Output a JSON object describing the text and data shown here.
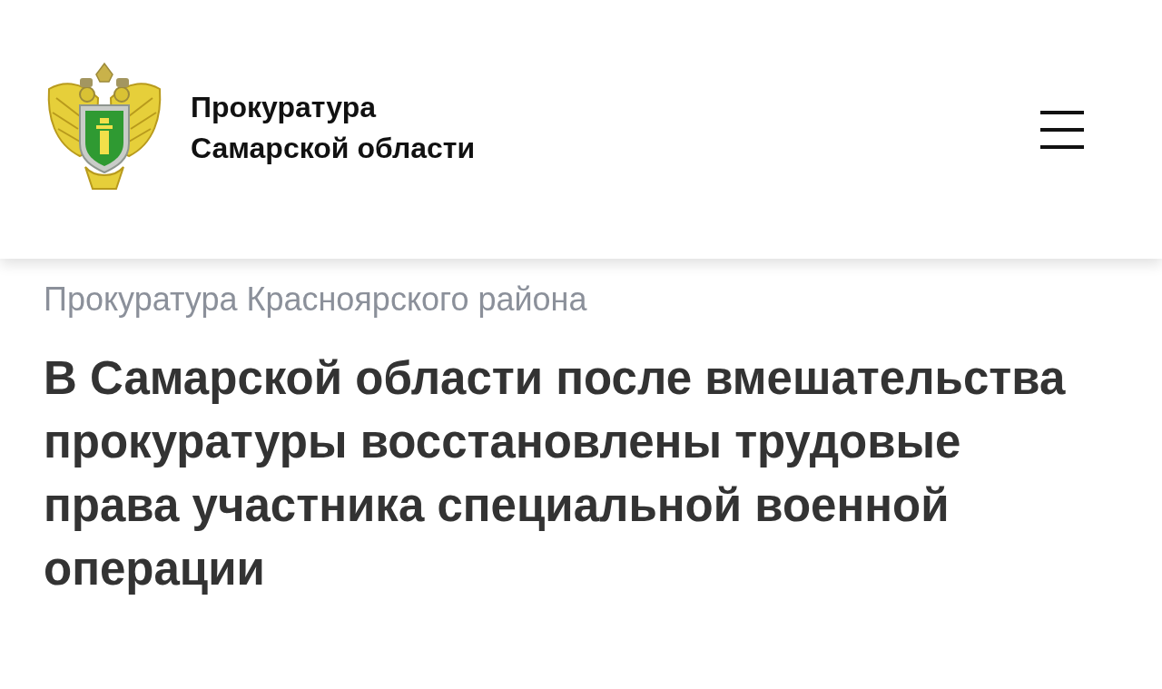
{
  "header": {
    "title": "Прокуратура Самарской области"
  },
  "breadcrumb": "Прокуратура Красноярского района",
  "headline": "В Самарской области после вмешательства прокуратуры восстановлены трудовые права участника специальной военной операции"
}
